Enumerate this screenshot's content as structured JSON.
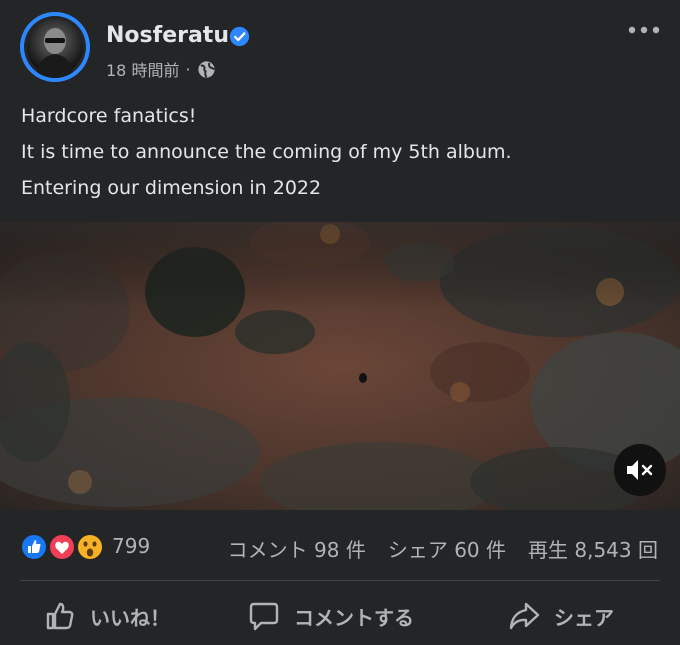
{
  "author": {
    "name": "Nosferatu",
    "timestamp": "18 時間前",
    "separator": "·",
    "verified": true,
    "accent_color": "#2d88ff"
  },
  "post": {
    "lines": [
      "Hardcore fanatics!",
      "It is time to announce the coming of my 5th album.",
      "Entering our dimension in 2022"
    ]
  },
  "video": {
    "muted": true,
    "mute_icon": "speaker-muted-icon"
  },
  "stats": {
    "reactions": [
      "like-icon",
      "love-icon",
      "wow-icon"
    ],
    "reaction_count": "799",
    "comments": "コメント 98 件",
    "shares": "シェア 60 件",
    "views": "再生 8,543 回"
  },
  "actions": {
    "like": "いいね！",
    "comment": "コメントする",
    "share": "シェア"
  },
  "colors": {
    "background": "#242526",
    "text": "#e4e6eb",
    "secondary_text": "#b0b3b8",
    "like_blue": "#1877f2",
    "love_red": "#f33e58",
    "wow_yellow": "#f7b125"
  }
}
